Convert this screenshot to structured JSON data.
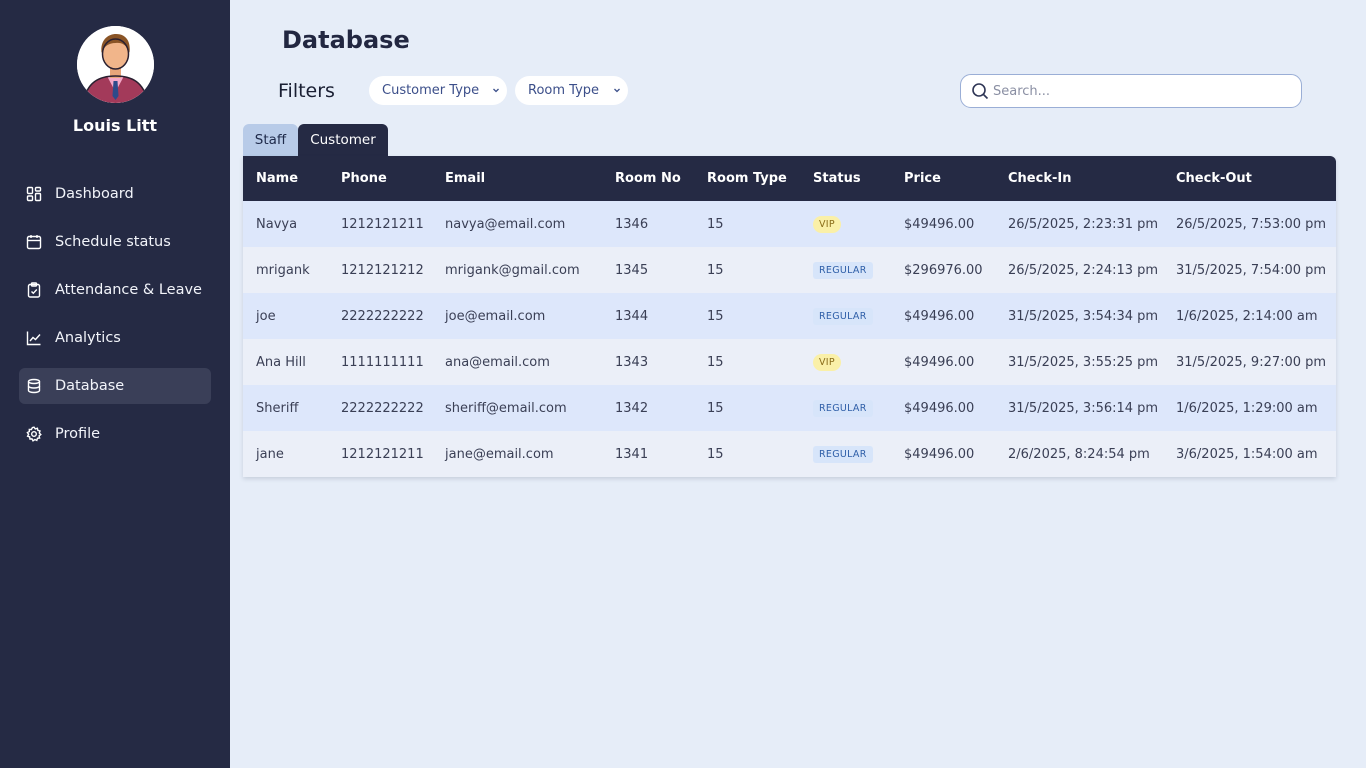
{
  "sidebar": {
    "user_name": "Louis Litt",
    "items": [
      {
        "label": "Dashboard",
        "icon": "dashboard-icon"
      },
      {
        "label": "Schedule status",
        "icon": "calendar-icon"
      },
      {
        "label": "Attendance & Leave",
        "icon": "clipboard-check-icon"
      },
      {
        "label": "Analytics",
        "icon": "line-chart-icon"
      },
      {
        "label": "Database",
        "icon": "database-icon",
        "active": true
      },
      {
        "label": "Profile",
        "icon": "gear-icon"
      }
    ]
  },
  "header": {
    "title": "Database",
    "filters_label": "Filters",
    "customer_type_select": "Customer Type",
    "room_type_select": "Room Type",
    "search_placeholder": "Search..."
  },
  "tabs": {
    "staff": "Staff",
    "customer": "Customer",
    "active": "Customer"
  },
  "table": {
    "columns": [
      "Name",
      "Phone",
      "Email",
      "Room No",
      "Room Type",
      "Status",
      "Price",
      "Check-In",
      "Check-Out"
    ],
    "rows": [
      {
        "name": "Navya",
        "phone": "1212121211",
        "email": "navya@email.com",
        "room_no": "1346",
        "room_type": "15",
        "status": "VIP",
        "price": "$49496.00",
        "check_in": "26/5/2025, 2:23:31 pm",
        "check_out": "26/5/2025, 7:53:00 pm"
      },
      {
        "name": "mrigank",
        "phone": "1212121212",
        "email": "mrigank@gmail.com",
        "room_no": "1345",
        "room_type": "15",
        "status": "REGULAR",
        "price": "$296976.00",
        "check_in": "26/5/2025, 2:24:13 pm",
        "check_out": "31/5/2025, 7:54:00 pm"
      },
      {
        "name": "joe",
        "phone": "2222222222",
        "email": "joe@email.com",
        "room_no": "1344",
        "room_type": "15",
        "status": "REGULAR",
        "price": "$49496.00",
        "check_in": "31/5/2025, 3:54:34 pm",
        "check_out": "1/6/2025, 2:14:00 am"
      },
      {
        "name": "Ana Hill",
        "phone": "1111111111",
        "email": "ana@email.com",
        "room_no": "1343",
        "room_type": "15",
        "status": "VIP",
        "price": "$49496.00",
        "check_in": "31/5/2025, 3:55:25 pm",
        "check_out": "31/5/2025, 9:27:00 pm"
      },
      {
        "name": "Sheriff",
        "phone": "2222222222",
        "email": "sheriff@email.com",
        "room_no": "1342",
        "room_type": "15",
        "status": "REGULAR",
        "price": "$49496.00",
        "check_in": "31/5/2025, 3:56:14 pm",
        "check_out": "1/6/2025, 1:29:00 am"
      },
      {
        "name": "jane",
        "phone": "1212121211",
        "email": "jane@email.com",
        "room_no": "1341",
        "room_type": "15",
        "status": "REGULAR",
        "price": "$49496.00",
        "check_in": "2/6/2025, 8:24:54 pm",
        "check_out": "3/6/2025, 1:54:00 am"
      }
    ]
  },
  "colors": {
    "sidebar_bg": "#252a44",
    "page_bg": "#e6edf8",
    "vip_badge": "#faf0a8",
    "regular_badge": "#d7e5fa"
  }
}
